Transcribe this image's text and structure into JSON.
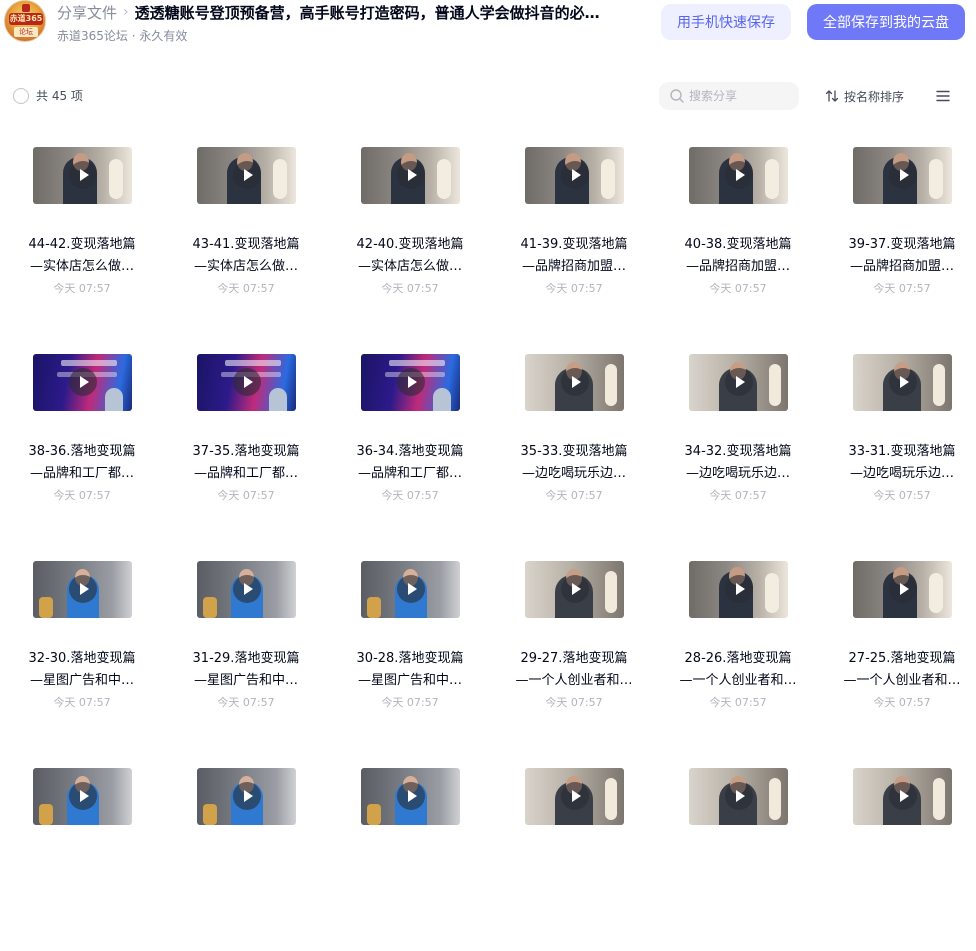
{
  "header": {
    "breadcrumb_root": "分享文件",
    "breadcrumb_sep": "›",
    "title": "透透糖账号登顶预备营，高手账号打造密码，普通人学会做抖音的必…",
    "owner": "赤道365论坛",
    "validity": "永久有效",
    "owner_separator": " · ",
    "avatar_text_top": "赤道365",
    "avatar_text_bottom": "论坛",
    "btn_phone_save": "用手机快速保存",
    "btn_save_all": "全部保存到我的云盘",
    "colors": {
      "accent": "#6f78f6",
      "accent_light": "#eef0ff",
      "accent_text": "#5964ee"
    }
  },
  "toolbar": {
    "count_label": "共 45 项",
    "search_placeholder": "搜索分享",
    "sort_label": "按名称排序",
    "icons": [
      "select-all-icon",
      "search-icon",
      "sort-icon",
      "list-view-icon"
    ]
  },
  "files": [
    {
      "line1": "44-42.变现落地篇",
      "line2": "—实体店怎么做…",
      "time": "今天 07:57",
      "thumb": "s-room"
    },
    {
      "line1": "43-41.变现落地篇",
      "line2": "—实体店怎么做…",
      "time": "今天 07:57",
      "thumb": "s-room"
    },
    {
      "line1": "42-40.变现落地篇",
      "line2": "—实体店怎么做…",
      "time": "今天 07:57",
      "thumb": "s-room"
    },
    {
      "line1": "41-39.变现落地篇",
      "line2": "—品牌招商加盟…",
      "time": "今天 07:57",
      "thumb": "s-room"
    },
    {
      "line1": "40-38.变现落地篇",
      "line2": "—品牌招商加盟…",
      "time": "今天 07:57",
      "thumb": "s-room"
    },
    {
      "line1": "39-37.变现落地篇",
      "line2": "—品牌招商加盟…",
      "time": "今天 07:57",
      "thumb": "s-room"
    },
    {
      "line1": "38-36.落地变现篇",
      "line2": "—品牌和工厂都…",
      "time": "今天 07:57",
      "thumb": "s-stage"
    },
    {
      "line1": "37-35.落地变现篇",
      "line2": "—品牌和工厂都…",
      "time": "今天 07:57",
      "thumb": "s-stage"
    },
    {
      "line1": "36-34.落地变现篇",
      "line2": "—品牌和工厂都…",
      "time": "今天 07:57",
      "thumb": "s-stage"
    },
    {
      "line1": "35-33.变现落地篇",
      "line2": "—边吃喝玩乐边…",
      "time": "今天 07:57",
      "thumb": "s-office"
    },
    {
      "line1": "34-32.变现落地篇",
      "line2": "—边吃喝玩乐边…",
      "time": "今天 07:57",
      "thumb": "s-office"
    },
    {
      "line1": "33-31.变现落地篇",
      "line2": "—边吃喝玩乐边…",
      "time": "今天 07:57",
      "thumb": "s-office"
    },
    {
      "line1": "32-30.落地变现篇",
      "line2": "—星图广告和中…",
      "time": "今天 07:57",
      "thumb": "s-wall"
    },
    {
      "line1": "31-29.落地变现篇",
      "line2": "—星图广告和中…",
      "time": "今天 07:57",
      "thumb": "s-wall"
    },
    {
      "line1": "30-28.落地变现篇",
      "line2": "—星图广告和中…",
      "time": "今天 07:57",
      "thumb": "s-wall"
    },
    {
      "line1": "29-27.落地变现篇",
      "line2": "—一个人创业者和…",
      "time": "今天 07:57",
      "thumb": "s-office"
    },
    {
      "line1": "28-26.落地变现篇",
      "line2": "—一个人创业者和…",
      "time": "今天 07:57",
      "thumb": "s-room"
    },
    {
      "line1": "27-25.落地变现篇",
      "line2": "—一个人创业者和…",
      "time": "今天 07:57",
      "thumb": "s-room"
    },
    {
      "line1": "",
      "line2": "",
      "time": "",
      "thumb": "s-wall"
    },
    {
      "line1": "",
      "line2": "",
      "time": "",
      "thumb": "s-wall"
    },
    {
      "line1": "",
      "line2": "",
      "time": "",
      "thumb": "s-wall"
    },
    {
      "line1": "",
      "line2": "",
      "time": "",
      "thumb": "s-office"
    },
    {
      "line1": "",
      "line2": "",
      "time": "",
      "thumb": "s-office"
    },
    {
      "line1": "",
      "line2": "",
      "time": "",
      "thumb": "s-office"
    }
  ]
}
